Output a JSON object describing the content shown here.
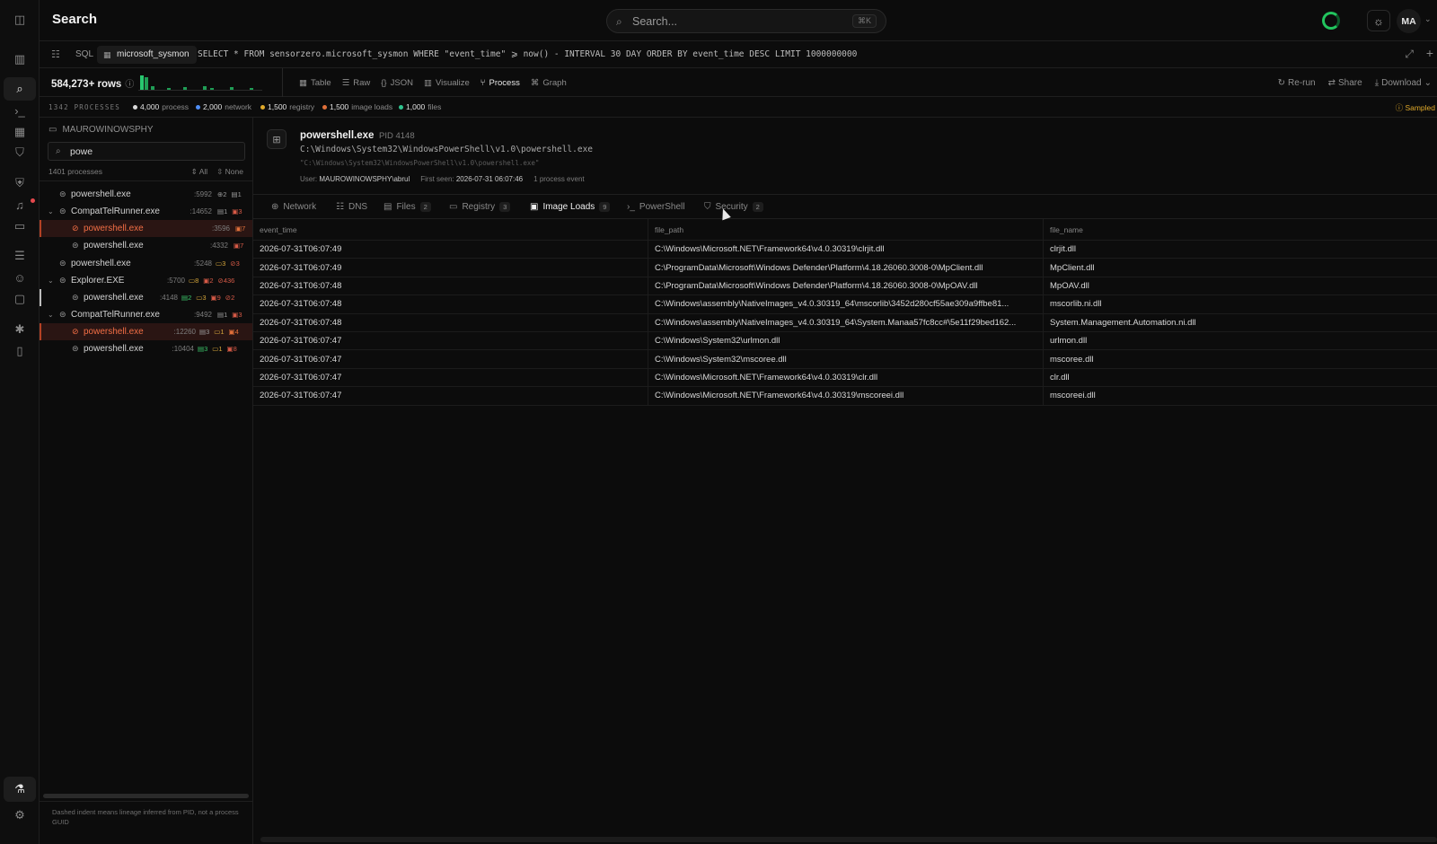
{
  "header": {
    "title": "Search",
    "search_placeholder": "Search...",
    "search_shortcut": "⌘K",
    "avatar_initials": "MA",
    "status_color": "#22c55e"
  },
  "rail": {
    "items": [
      "sidebar-toggle-icon",
      "chart-icon",
      "search-icon",
      "terminal-icon",
      "grid-icon",
      "shield-check-icon",
      "shield-icon",
      "bell-icon",
      "folder-icon",
      "server-icon",
      "users-icon",
      "window-icon",
      "bug-icon",
      "book-icon",
      "flask-icon",
      "settings-icon"
    ]
  },
  "sqlbar": {
    "label": "SQL",
    "table": "microsoft_sysmon",
    "query": "SELECT * FROM sensorzero.microsoft_sysmon WHERE \"event_time\" ⩾ now() - INTERVAL 30 DAY ORDER BY event_time DESC LIMIT 1000000000"
  },
  "toolbar": {
    "rows": "584,273+ rows",
    "views": [
      "Table",
      "Raw",
      "JSON",
      "Visualize",
      "Process",
      "Graph"
    ],
    "active_view": "Process",
    "actions": [
      "Re-run",
      "Share",
      "Download"
    ]
  },
  "stats": {
    "processes_label": "1342 PROCESSES",
    "items": [
      {
        "count": "4,000",
        "label": "process",
        "color": "#d9d9d9"
      },
      {
        "count": "2,000",
        "label": "network",
        "color": "#4f8ef7"
      },
      {
        "count": "1,500",
        "label": "registry",
        "color": "#e0a92a"
      },
      {
        "count": "1,500",
        "label": "image loads",
        "color": "#e0703a"
      },
      {
        "count": "1,000",
        "label": "files",
        "color": "#2fc48e"
      }
    ],
    "sampled": "Sampled"
  },
  "tree": {
    "host": "MAUROWINOWSPHY",
    "filter_value": "powe",
    "count": "1401 processes",
    "all": "All",
    "none": "None",
    "rows": [
      {
        "name": "powershell.exe",
        "pid": ":5992",
        "b1": "2",
        "b2": "1",
        "b3": ""
      },
      {
        "name": "CompatTelRunner.exe",
        "pid": ":14652",
        "b1": "1",
        "b2": "3",
        "b3": ""
      },
      {
        "name": "powershell.exe",
        "pid": ":3596",
        "b1": "7",
        "b2": "",
        "b3": ""
      },
      {
        "name": "powershell.exe",
        "pid": ":4332",
        "b1": "7",
        "b2": "",
        "b3": ""
      },
      {
        "name": "powershell.exe",
        "pid": ":5248",
        "b1": "3",
        "b2": "3",
        "b3": ""
      },
      {
        "name": "Explorer.EXE",
        "pid": ":5700",
        "b1": "8",
        "b2": "2",
        "b3": "436"
      },
      {
        "name": "powershell.exe",
        "pid": ":4148",
        "b1": "2",
        "b2": "3",
        "b3": "9"
      },
      {
        "name": "CompatTelRunner.exe",
        "pid": ":9492",
        "b1": "1",
        "b2": "3",
        "b3": ""
      },
      {
        "name": "powershell.exe",
        "pid": ":12260",
        "b1": "3",
        "b2": "1",
        "b3": "4"
      },
      {
        "name": "powershell.exe",
        "pid": ":10404",
        "b1": "3",
        "b2": "1",
        "b3": "8"
      }
    ],
    "footnote": "Dashed indent means lineage inferred from PID, not a process GUID"
  },
  "detail": {
    "name": "powershell.exe",
    "pid": "PID 4148",
    "path": "C:\\Windows\\System32\\WindowsPowerShell\\v1.0\\powershell.exe",
    "cmd": "\"C:\\Windows\\System32\\WindowsPowerShell\\v1.0\\powershell.exe\"",
    "user_label": "User:",
    "user": "MAUROWINOWSPHY\\abrul",
    "first_seen_label": "First seen:",
    "first_seen": "2026-07-31 06:07:46",
    "events": "1 process event"
  },
  "tabs": [
    {
      "label": "Network",
      "count": ""
    },
    {
      "label": "DNS",
      "count": ""
    },
    {
      "label": "Files",
      "count": "2"
    },
    {
      "label": "Registry",
      "count": "3"
    },
    {
      "label": "Image Loads",
      "count": "9"
    },
    {
      "label": "PowerShell",
      "count": ""
    },
    {
      "label": "Security",
      "count": "2"
    }
  ],
  "table": {
    "columns": [
      "event_time",
      "file_path",
      "file_name"
    ],
    "rows": [
      [
        "2026-07-31T06:07:49",
        "C:\\Windows\\Microsoft.NET\\Framework64\\v4.0.30319\\clrjit.dll",
        "clrjit.dll"
      ],
      [
        "2026-07-31T06:07:49",
        "C:\\ProgramData\\Microsoft\\Windows Defender\\Platform\\4.18.26060.3008-0\\MpClient.dll",
        "MpClient.dll"
      ],
      [
        "2026-07-31T06:07:48",
        "C:\\ProgramData\\Microsoft\\Windows Defender\\Platform\\4.18.26060.3008-0\\MpOAV.dll",
        "MpOAV.dll"
      ],
      [
        "2026-07-31T06:07:48",
        "C:\\Windows\\assembly\\NativeImages_v4.0.30319_64\\mscorlib\\3452d280cf55ae309a9ffbe81...",
        "mscorlib.ni.dll"
      ],
      [
        "2026-07-31T06:07:48",
        "C:\\Windows\\assembly\\NativeImages_v4.0.30319_64\\System.Manaa57fc8cc#\\5e11f29bed162...",
        "System.Management.Automation.ni.dll"
      ],
      [
        "2026-07-31T06:07:47",
        "C:\\Windows\\System32\\urlmon.dll",
        "urlmon.dll"
      ],
      [
        "2026-07-31T06:07:47",
        "C:\\Windows\\System32\\mscoree.dll",
        "mscoree.dll"
      ],
      [
        "2026-07-31T06:07:47",
        "C:\\Windows\\Microsoft.NET\\Framework64\\v4.0.30319\\clr.dll",
        "clr.dll"
      ],
      [
        "2026-07-31T06:07:47",
        "C:\\Windows\\Microsoft.NET\\Framework64\\v4.0.30319\\mscoreei.dll",
        "mscoreei.dll"
      ]
    ]
  }
}
